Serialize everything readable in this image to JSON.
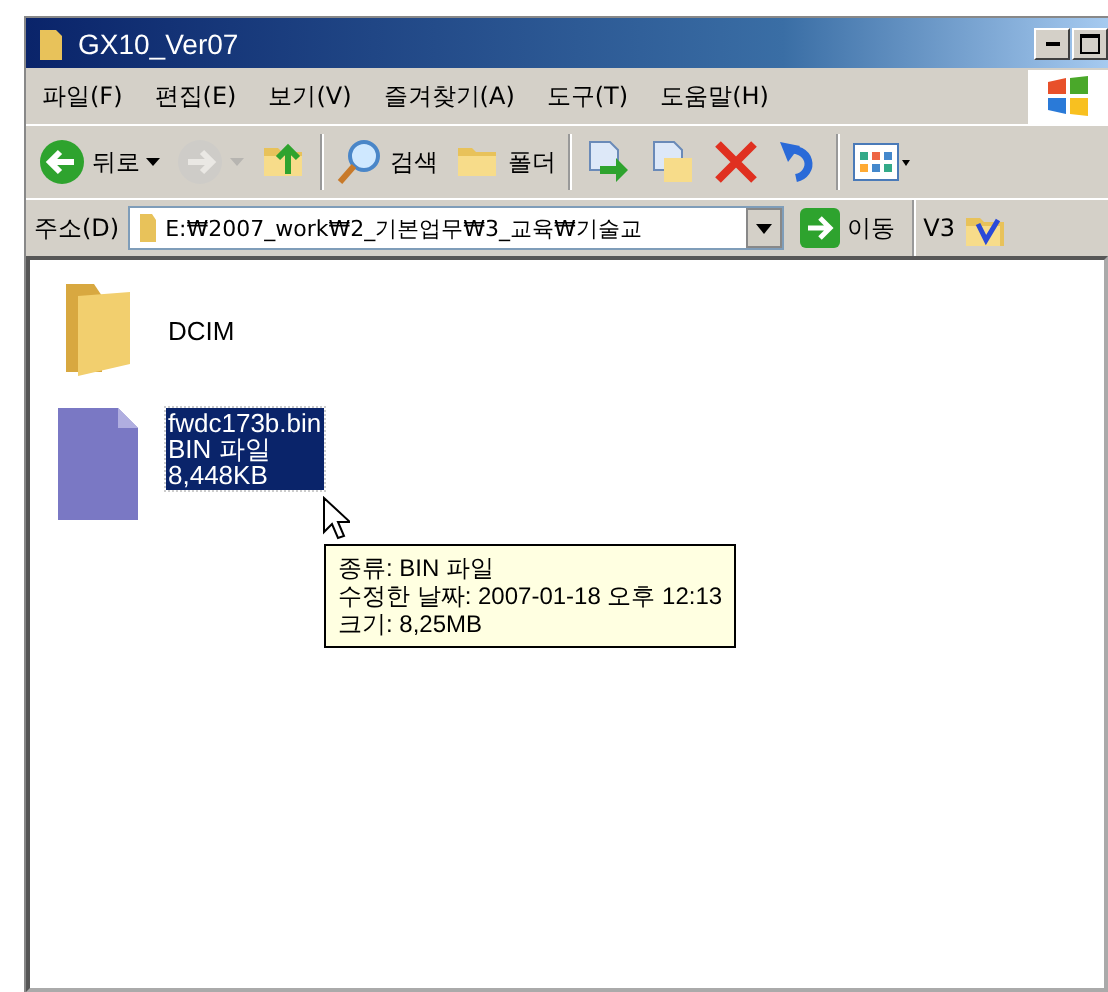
{
  "window": {
    "title": "GX10_Ver07"
  },
  "menu": [
    "파일(F)",
    "편집(E)",
    "보기(V)",
    "즐겨찾기(A)",
    "도구(T)",
    "도움말(H)"
  ],
  "toolbar": [
    {
      "kind": "back",
      "label": "뒤로",
      "disabled": false
    },
    {
      "kind": "forward",
      "disabled": true
    },
    {
      "kind": "up",
      "disabled": false
    },
    {
      "kind": "search",
      "label": "검색",
      "disabled": false
    },
    {
      "kind": "folders",
      "label": "폴더",
      "disabled": false
    },
    {
      "kind": "move",
      "disabled": false
    },
    {
      "kind": "copy",
      "disabled": false
    },
    {
      "kind": "delete",
      "disabled": false
    },
    {
      "kind": "undo",
      "disabled": false
    },
    {
      "kind": "views",
      "disabled": false
    }
  ],
  "address_bar": {
    "label": "주소(D)",
    "value": "E:₩2007_work₩2_기본업무₩3_교육₩기술교",
    "go_label": "이동",
    "extra_label": "V3"
  },
  "items": [
    {
      "kind": "folder",
      "lines": [
        "DCIM"
      ],
      "selected": false
    },
    {
      "kind": "file",
      "lines": [
        "fwdc173b.bin",
        "BIN 파일",
        "8,448KB"
      ],
      "selected": true
    }
  ],
  "tooltip": [
    "종류: BIN 파일",
    "수정한 날짜: 2007-01-18 오후 12:13",
    "크기: 8,25MB"
  ]
}
